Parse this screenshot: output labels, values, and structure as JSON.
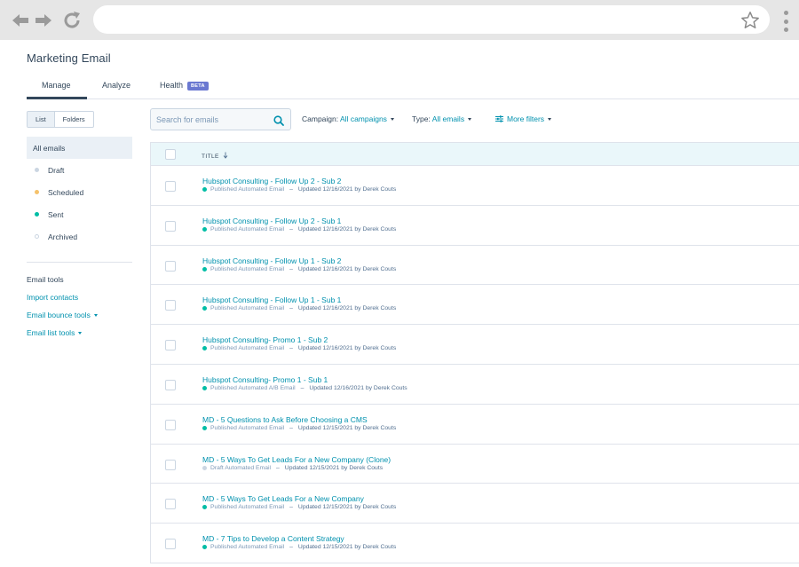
{
  "app": {
    "title": "Marketing Email",
    "tabs": [
      {
        "label": "Manage",
        "active": true
      },
      {
        "label": "Analyze",
        "active": false
      },
      {
        "label": "Health",
        "badge": "BETA",
        "active": false
      }
    ]
  },
  "sidebar": {
    "view_toggle": [
      "List",
      "Folders"
    ],
    "items": [
      {
        "label": "All emails",
        "selected": true
      },
      {
        "label": "Draft",
        "dot_color": "#cbd6e2"
      },
      {
        "label": "Scheduled",
        "dot_color": "#f5c26b"
      },
      {
        "label": "Sent",
        "dot_color": "#00bda5"
      },
      {
        "label": "Archived",
        "dot_color": "#ffffff"
      }
    ],
    "tools_heading": "Email tools",
    "tools": [
      {
        "label": "Import contacts",
        "dropdown": false
      },
      {
        "label": "Email bounce tools",
        "dropdown": true
      },
      {
        "label": "Email list tools",
        "dropdown": true
      }
    ]
  },
  "filters": {
    "search_placeholder": "Search for emails",
    "campaign_label": "Campaign:",
    "campaign_value": "All campaigns",
    "type_label": "Type:",
    "type_value": "All emails",
    "more_filters": "More filters"
  },
  "table": {
    "column_title": "TITLE",
    "rows": [
      {
        "title": "Hubspot Consulting - Follow Up 2 - Sub 2",
        "status": "Published Automated Email",
        "status_color": "#00bda5",
        "updated": "Updated 12/16/2021 by Derek Couts"
      },
      {
        "title": "Hubspot Consulting - Follow Up 2 - Sub 1",
        "status": "Published Automated Email",
        "status_color": "#00bda5",
        "updated": "Updated 12/16/2021 by Derek Couts"
      },
      {
        "title": "Hubspot Consulting - Follow Up 1 - Sub 2",
        "status": "Published Automated Email",
        "status_color": "#00bda5",
        "updated": "Updated 12/16/2021 by Derek Couts"
      },
      {
        "title": "Hubspot Consulting - Follow Up 1 - Sub 1",
        "status": "Published Automated Email",
        "status_color": "#00bda5",
        "updated": "Updated 12/16/2021 by Derek Couts"
      },
      {
        "title": "Hubspot Consulting- Promo 1 - Sub 2",
        "status": "Published Automated Email",
        "status_color": "#00bda5",
        "updated": "Updated 12/16/2021 by Derek Couts"
      },
      {
        "title": "Hubspot Consulting- Promo 1 - Sub 1",
        "status": "Published Automated A/B Email",
        "status_color": "#00bda5",
        "updated": "Updated 12/16/2021 by Derek Couts"
      },
      {
        "title": "MD - 5 Questions to Ask Before Choosing a CMS",
        "status": "Published Automated Email",
        "status_color": "#00bda5",
        "updated": "Updated 12/15/2021 by Derek Couts"
      },
      {
        "title": "MD - 5 Ways To Get Leads For a New Company (Clone)",
        "status": "Draft Automated Email",
        "status_color": "#cbd6e2",
        "updated": "Updated 12/15/2021 by Derek Couts"
      },
      {
        "title": "MD - 5 Ways To Get Leads For a New Company",
        "status": "Published Automated Email",
        "status_color": "#00bda5",
        "updated": "Updated 12/15/2021 by Derek Couts"
      },
      {
        "title": "MD - 7 Tips to Develop a Content Strategy",
        "status": "Published Automated Email",
        "status_color": "#00bda5",
        "updated": "Updated 12/15/2021 by Derek Couts"
      }
    ]
  }
}
